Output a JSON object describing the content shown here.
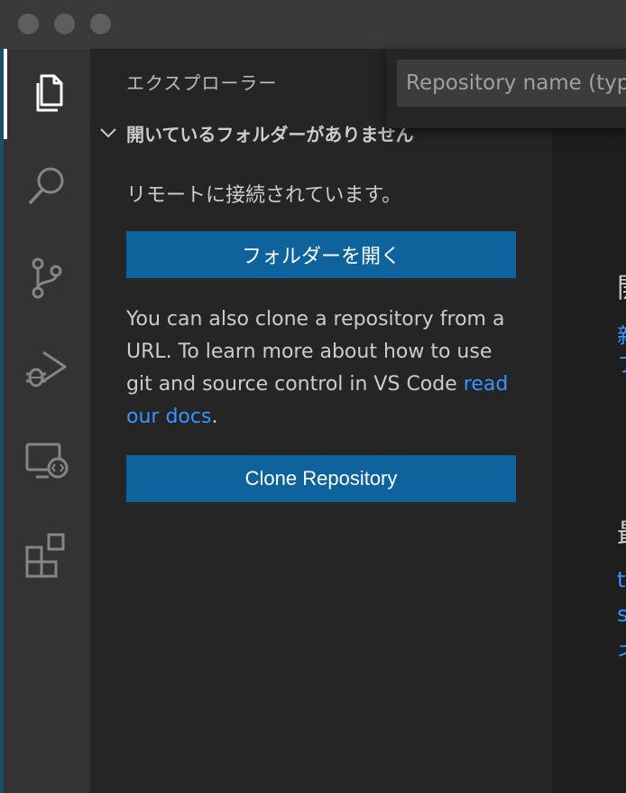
{
  "sidebar": {
    "title": "エクスプローラー",
    "section_label": "開いているフォルダーがありません",
    "remote_text": "リモートに接続されています。",
    "open_folder_label": "フォルダーを開く",
    "clone_text_before": "You can also clone a repository from a URL. To learn more about how to use git and source control in VS Code ",
    "clone_link": "read our docs",
    "clone_text_after": ".",
    "clone_button_label": "Clone Repository"
  },
  "quick_pick": {
    "placeholder": "Repository name (type to search)"
  },
  "activity_bar": {
    "items": [
      "explorer",
      "search",
      "source-control",
      "run-debug",
      "remote-explorer",
      "extensions"
    ]
  },
  "editor_peek": {
    "heading_1": "開",
    "link_1a": "新",
    "link_1b": "フ",
    "heading_2": "最",
    "link_2a": "t",
    "link_2b": "s",
    "link_2c": "ネ"
  },
  "colors": {
    "accent_button": "#0e639c",
    "link": "#3794ff",
    "sidebar_bg": "#252526",
    "activity_bg": "#333333"
  }
}
